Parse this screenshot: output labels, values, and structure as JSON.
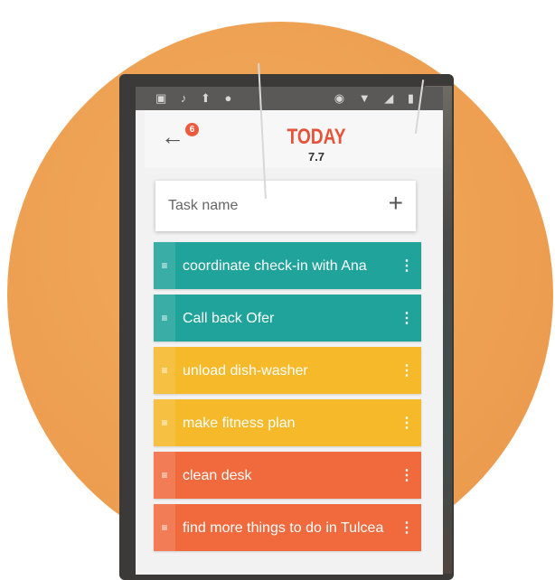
{
  "app": {
    "title": "TODAY",
    "date": "7.7",
    "notification_count": "6"
  },
  "statusbar": {
    "left_icons": "▣ ♪ ⬆ ●",
    "right_icons": "◉ ▼ ◢ ▮"
  },
  "input": {
    "placeholder": "Task name",
    "add_symbol": "+"
  },
  "tasks": [
    {
      "label": "coordinate check-in with Ana",
      "color": "#1fa39a"
    },
    {
      "label": "Call back Ofer",
      "color": "#1fa39a"
    },
    {
      "label": "unload dish-washer",
      "color": "#f5b92a"
    },
    {
      "label": "make fitness plan",
      "color": "#f5b92a"
    },
    {
      "label": "clean desk",
      "color": "#f06a3e"
    },
    {
      "label": "find more things to do in Tulcea",
      "color": "#f06a3e"
    }
  ],
  "icons": {
    "back": "←",
    "drag_handle": "≡",
    "menu": "⋮"
  },
  "colors": {
    "accent": "#e5543a",
    "background_circle": "#eea052"
  }
}
